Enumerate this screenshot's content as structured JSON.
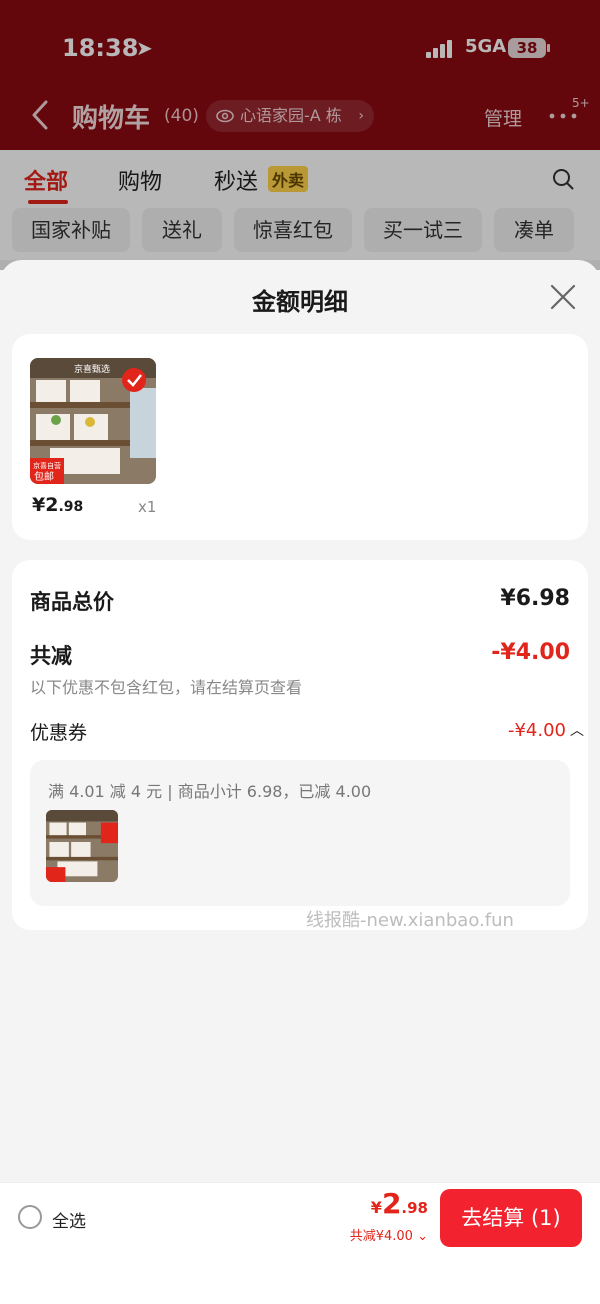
{
  "status_bar": {
    "time": "18:38",
    "network": "5GA",
    "battery": "38"
  },
  "nav": {
    "title": "购物车",
    "count": "(40)",
    "address": "心语家园-A 栋",
    "manage": "管理",
    "more_badge": "5+"
  },
  "tabs": [
    {
      "label": "全部",
      "active": true
    },
    {
      "label": "购物",
      "active": false
    },
    {
      "label": "秒送",
      "active": false
    }
  ],
  "tab_badge": "外卖",
  "chips": [
    "国家补贴",
    "送礼",
    "惊喜红包",
    "买一试三",
    "凑单"
  ],
  "sheet": {
    "title": "金额明细",
    "product": {
      "price_int": "¥2",
      "price_dec": ".98",
      "qty": "x1",
      "tag_top": "京喜甄选",
      "tag_bottom": "京喜自营",
      "tag_bottom2": "包邮"
    },
    "summary": {
      "goods_total_label": "商品总价",
      "goods_total_value": "¥6.98",
      "discount_label": "共减",
      "discount_value": "-¥4.00",
      "note": "以下优惠不包含红包，请在结算页查看",
      "coupon_label": "优惠券",
      "coupon_value": "-¥4.00",
      "coupon_desc": "满 4.01 减 4 元 | 商品小计 6.98，已减 4.00"
    }
  },
  "watermark": "线报酷-new.xianbao.fun",
  "bottom": {
    "select_all": "全选",
    "total_cur": "¥",
    "total_int": "2",
    "total_dec": ".98",
    "saved": "共减¥4.00",
    "checkout": "去结算 (1)"
  },
  "colors": {
    "accent": "#e1251b",
    "header_bg": "#8a0a12",
    "checkout_bg": "#f2232f"
  }
}
